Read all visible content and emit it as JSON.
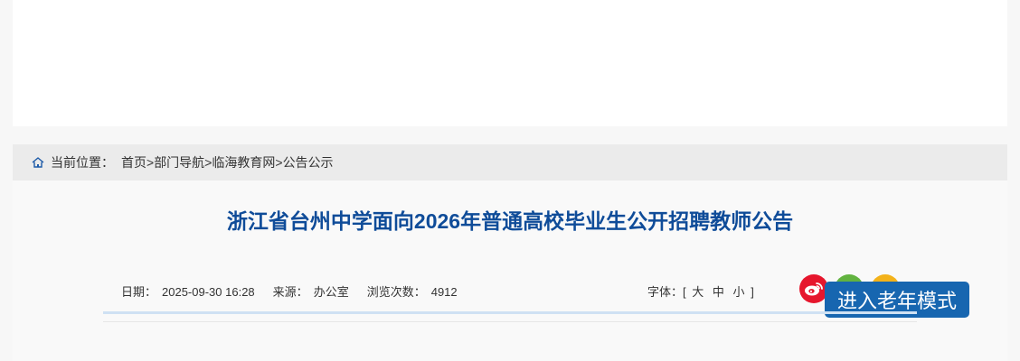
{
  "breadcrumb": {
    "label": "当前位置：",
    "items": [
      "首页",
      "部门导航",
      "临海教育网",
      "公告公示"
    ],
    "separator": ">"
  },
  "article": {
    "title": "浙江省台州中学面向2026年普通高校毕业生公开招聘教师公告"
  },
  "meta": {
    "date_label": "日期：",
    "date_value": "2025-09-30 16:28",
    "source_label": "来源：",
    "source_value": "办公室",
    "views_label": "浏览次数：",
    "views_value": "4912"
  },
  "font_size": {
    "label": "字体：",
    "open_bracket": "[",
    "large": "大",
    "medium": "中",
    "small": "小",
    "close_bracket": "]"
  },
  "share": {
    "icons": [
      "weibo-icon",
      "wechat-icon",
      "qzone-icon"
    ]
  },
  "elder_mode": {
    "label": "进入老年模式"
  },
  "colors": {
    "title": "#0f4c99",
    "elder_button": "#1766b0",
    "weibo": "#e6162d",
    "wechat": "#62b340",
    "qzone": "#f3b21a"
  }
}
